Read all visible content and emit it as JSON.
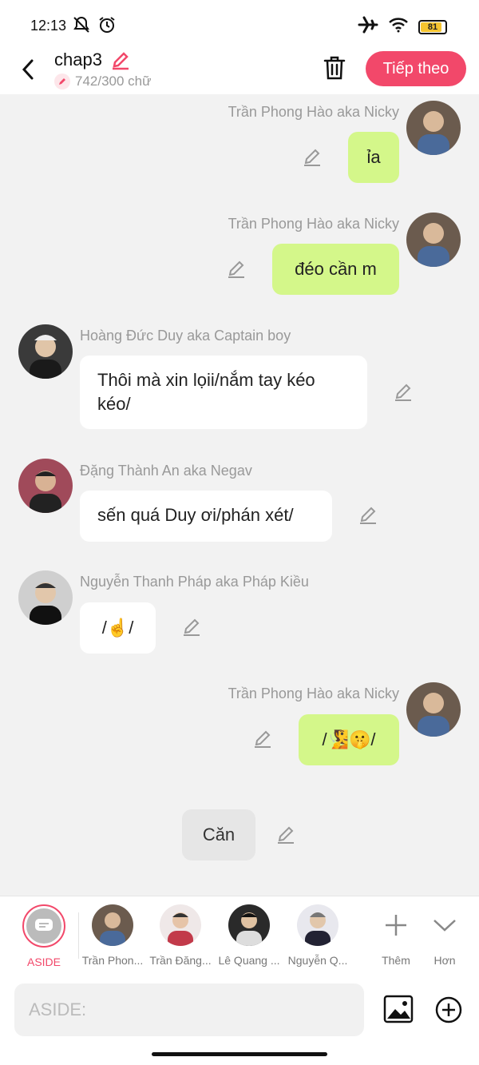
{
  "status": {
    "time": "12:13",
    "battery": "81",
    "left_icons": [
      "mute-icon",
      "alarm-icon"
    ],
    "right_icons": [
      "airplane-icon",
      "wifi-icon",
      "battery-icon"
    ]
  },
  "header": {
    "title": "chap3",
    "word_count": "742/300 chữ",
    "next_label": "Tiếp theo"
  },
  "messages": [
    {
      "side": "right",
      "sender": "Trần Phong Hào aka Nicky",
      "text": "ỉa"
    },
    {
      "side": "right",
      "sender": "Trần Phong Hào aka Nicky",
      "text": "đéo cần m"
    },
    {
      "side": "left",
      "sender": "Hoàng Đức Duy aka Captain boy",
      "text": "Thôi mà xin lọii/nắm tay kéo kéo/"
    },
    {
      "side": "left",
      "sender": "Đặng Thành An aka Negav",
      "text": "sến quá Duy ơi/phán xét/"
    },
    {
      "side": "left",
      "sender": "Nguyễn Thanh Pháp aka Pháp Kiều",
      "text": "/☝️/"
    },
    {
      "side": "right",
      "sender": "Trần Phong Hào aka Nicky",
      "text": "/🧏🤫/"
    },
    {
      "side": "center",
      "sender": "",
      "text": "Căn"
    }
  ],
  "characters": {
    "aside_label": "ASIDE",
    "items": [
      "Trần Phon...",
      "Trần Đăng...",
      "Lê Quang ...",
      "Nguyễn Q..."
    ],
    "more_label": "Thêm",
    "less_label": "Hơn"
  },
  "input": {
    "placeholder": "ASIDE:"
  },
  "colors": {
    "accent": "#f2486a",
    "bubble_self": "#d4f78a",
    "bubble_other": "#ffffff",
    "background": "#f2f2f2"
  }
}
